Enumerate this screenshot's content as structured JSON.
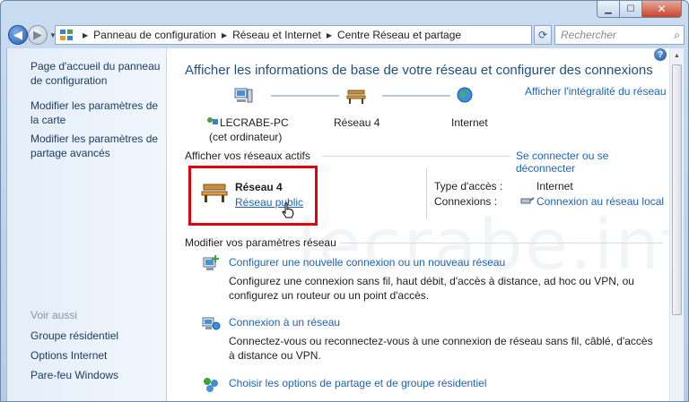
{
  "window": {
    "controls": {
      "minimize": "▁",
      "maximize": "☐",
      "close": "✕"
    }
  },
  "navbar": {
    "breadcrumb": [
      "Panneau de configuration",
      "Réseau et Internet",
      "Centre Réseau et partage"
    ],
    "search_placeholder": "Rechercher",
    "icons": {
      "back": "back-arrow-icon",
      "forward": "forward-arrow-icon",
      "refresh": "refresh-icon",
      "search": "search-icon"
    }
  },
  "sidebar": {
    "links": [
      "Page d'accueil du panneau de configuration",
      "Modifier les paramètres de la carte",
      "Modifier les paramètres de partage avancés"
    ],
    "see_also_header": "Voir aussi",
    "see_also": [
      "Groupe résidentiel",
      "Options Internet",
      "Pare-feu Windows"
    ]
  },
  "main": {
    "title": "Afficher les informations de base de votre réseau et configurer des connexions",
    "full_map_link": "Afficher l'intégralité du réseau",
    "map_nodes": [
      {
        "label_line1": "LECRABE-PC",
        "label_line2": "(cet ordinateur)",
        "icon": "computer-icon"
      },
      {
        "label_line1": "Réseau  4",
        "icon": "bench-icon"
      },
      {
        "label_line1": "Internet",
        "icon": "globe-icon"
      }
    ],
    "active_networks_header": "Afficher vos réseaux actifs",
    "connect_link": "Se connecter ou se déconnecter",
    "network": {
      "name": "Réseau  4",
      "type": "Réseau public",
      "access_type_label": "Type d'accès :",
      "access_type_value": "Internet",
      "connections_label": "Connexions :",
      "connections_value": "Connexion au réseau local"
    },
    "settings_header": "Modifier vos paramètres réseau",
    "tasks": [
      {
        "link": "Configurer une nouvelle connexion ou un nouveau réseau",
        "desc": "Configurez une connexion sans fil, haut débit, d'accès à distance, ad hoc ou VPN, ou configurez un routeur ou un point d'accès."
      },
      {
        "link": "Connexion à un réseau",
        "desc": "Connectez-vous ou reconnectez-vous à une connexion de réseau sans fil, câblé, d'accès à distance ou VPN."
      },
      {
        "link": "Choisir les options de partage et de groupe résidentiel",
        "desc": ""
      }
    ]
  },
  "watermark": "lecrabe.info",
  "colors": {
    "link": "#1f63b8",
    "title": "#1c5180",
    "highlight_border": "#e3000f",
    "sidebar_bg": "#e4eef9"
  }
}
